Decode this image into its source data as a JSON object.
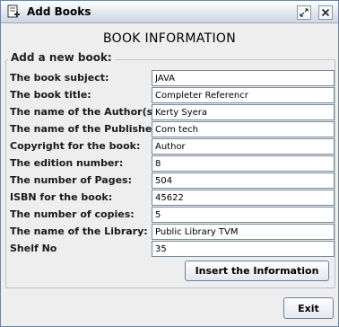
{
  "window": {
    "title": "Add Books"
  },
  "heading": "BOOK INFORMATION",
  "group_title": "Add a new book:",
  "fields": [
    {
      "label": "The book subject:",
      "value": "JAVA"
    },
    {
      "label": "The book title:",
      "value": "Completer Referencr"
    },
    {
      "label": "The name of the Author(s):",
      "value": "Kerty Syera"
    },
    {
      "label": "The name of the Publisher:",
      "value": "Com tech"
    },
    {
      "label": "Copyright for the book:",
      "value": "Author"
    },
    {
      "label": "The edition number:",
      "value": "8"
    },
    {
      "label": "The number of Pages:",
      "value": "504"
    },
    {
      "label": "ISBN for the book:",
      "value": "45622"
    },
    {
      "label": "The number of copies:",
      "value": "5"
    },
    {
      "label": "The name of the Library:",
      "value": "Public Library TVM"
    },
    {
      "label": "Shelf No",
      "value": "35"
    }
  ],
  "buttons": {
    "insert": "Insert the Information",
    "exit": "Exit"
  },
  "icons": {
    "window": "book-add-icon",
    "restore": "restore-icon",
    "close": "close-icon"
  },
  "colors": {
    "title_bar": "#dfe5ee",
    "border": "#6d84a3",
    "background": "#eeeeee"
  }
}
